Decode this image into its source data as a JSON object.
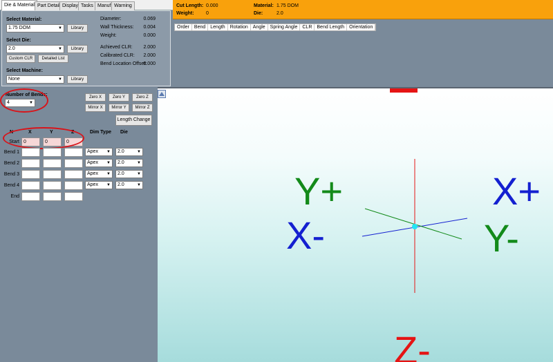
{
  "tabs": [
    {
      "label": "Die & Material",
      "active": true
    },
    {
      "label": "Part Details",
      "active": false
    },
    {
      "label": "Display",
      "active": false
    },
    {
      "label": "Tasks",
      "active": false
    },
    {
      "label": "Manuf.",
      "active": false
    },
    {
      "label": "Warning",
      "active": false
    }
  ],
  "material": {
    "heading": "Select Material:",
    "value": "1.75 DOM",
    "library_button": "Library"
  },
  "die": {
    "heading": "Select Die:",
    "value": "2.0",
    "library_button": "Library",
    "custom_clr_button": "Custom CLR",
    "detailed_list_button": "Detailed List"
  },
  "machine": {
    "heading": "Select Machine:",
    "value": "None",
    "library_button": "Library"
  },
  "specs": {
    "diameter_label": "Diameter:",
    "diameter_value": "0.069",
    "wall_label": "Wall Thickness:",
    "wall_value": "0.004",
    "weight_label": "Weight:",
    "weight_value": "0.000",
    "achieved_label": "Achieved CLR:",
    "achieved_value": "2.000",
    "calibrated_label": "Calibrated CLR:",
    "calibrated_value": "2.000",
    "offset_label": "Bend Location Offset:",
    "offset_value": "0.000"
  },
  "bends": {
    "heading": "Number of Bends:",
    "value": "4"
  },
  "transform_buttons": {
    "zero_x": "Zero X",
    "zero_y": "Zero Y",
    "zero_z": "Zero Z",
    "mirror_x": "Mirror X",
    "mirror_y": "Mirror Y",
    "mirror_z": "Mirror Z",
    "length_change": "Length Change"
  },
  "grid": {
    "col_n": "N",
    "col_x": "X",
    "col_y": "Y",
    "col_z": "Z",
    "col_dim": "Dim Type",
    "col_die": "Die",
    "start_label": "Start",
    "start_x": "0",
    "start_y": "0",
    "start_z": "0",
    "rows": [
      {
        "label": "Bend 1",
        "dim": "Apex",
        "die": "2.0"
      },
      {
        "label": "Bend 2",
        "dim": "Apex",
        "die": "2.0"
      },
      {
        "label": "Bend 3",
        "dim": "Apex",
        "die": "2.0"
      },
      {
        "label": "Bend 4",
        "dim": "Apex",
        "die": "2.0"
      }
    ],
    "end_label": "End"
  },
  "status": {
    "cut_length_label": "Cut Length:",
    "cut_length_value": "0.000",
    "weight_label": "Weight:",
    "weight_value": "0",
    "material_label": "Material:",
    "material_value": "1.75 DOM",
    "die_label": "Die:",
    "die_value": "2.0"
  },
  "table_columns": [
    "Order",
    "Bend",
    "Length",
    "Rotation",
    "Angle",
    "Spring Angle",
    "CLR",
    "Bend Length",
    "Orientation"
  ],
  "axes": {
    "y_plus": "Y+",
    "x_plus": "X+",
    "x_minus": "X-",
    "y_minus": "Y-",
    "z_minus": "Z-",
    "y_color": "#138a1a",
    "x_color": "#1420d0",
    "z_color": "#e51414"
  }
}
